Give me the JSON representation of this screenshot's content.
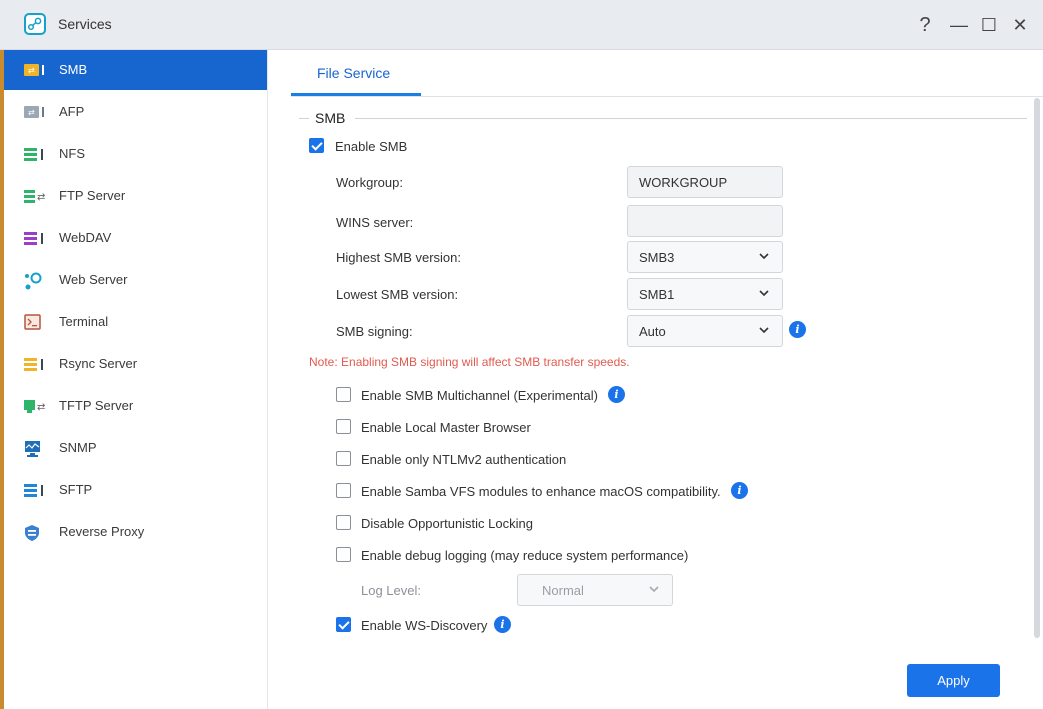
{
  "window": {
    "title": "Services",
    "controls": {
      "help": "?",
      "minimize": "—",
      "maximize": "☐",
      "close": "✕"
    }
  },
  "sidebar": {
    "items": [
      {
        "label": "SMB",
        "icon": "smb-icon",
        "active": true
      },
      {
        "label": "AFP",
        "icon": "afp-icon"
      },
      {
        "label": "NFS",
        "icon": "nfs-icon"
      },
      {
        "label": "FTP Server",
        "icon": "ftp-icon"
      },
      {
        "label": "WebDAV",
        "icon": "webdav-icon"
      },
      {
        "label": "Web Server",
        "icon": "web-server-icon"
      },
      {
        "label": "Terminal",
        "icon": "terminal-icon"
      },
      {
        "label": "Rsync Server",
        "icon": "rsync-icon"
      },
      {
        "label": "TFTP Server",
        "icon": "tftp-icon"
      },
      {
        "label": "SNMP",
        "icon": "snmp-icon"
      },
      {
        "label": "SFTP",
        "icon": "sftp-icon"
      },
      {
        "label": "Reverse Proxy",
        "icon": "reverse-proxy-icon"
      }
    ]
  },
  "tabs": [
    {
      "label": "File Service",
      "active": true
    }
  ],
  "smb": {
    "section_title": "SMB",
    "enable_smb": {
      "label": "Enable SMB",
      "checked": true
    },
    "workgroup": {
      "label": "Workgroup:",
      "value": "WORKGROUP"
    },
    "wins_server": {
      "label": "WINS server:",
      "value": ""
    },
    "highest_version": {
      "label": "Highest SMB version:",
      "value": "SMB3"
    },
    "lowest_version": {
      "label": "Lowest SMB version:",
      "value": "SMB1"
    },
    "signing": {
      "label": "SMB signing:",
      "value": "Auto"
    },
    "note": "Note: Enabling SMB signing will affect SMB transfer speeds.",
    "options": [
      {
        "label": "Enable SMB Multichannel (Experimental)",
        "checked": false,
        "info": true
      },
      {
        "label": "Enable Local Master Browser",
        "checked": false
      },
      {
        "label": "Enable only NTLMv2 authentication",
        "checked": false
      },
      {
        "label": "Enable Samba VFS modules to enhance macOS compatibility.",
        "checked": false,
        "info": true
      },
      {
        "label": "Disable Opportunistic Locking",
        "checked": false
      },
      {
        "label": "Enable debug logging (may reduce system performance)",
        "checked": false
      }
    ],
    "log_level": {
      "label": "Log Level:",
      "value": "Normal",
      "disabled": true
    },
    "ws_discovery": {
      "label": "Enable WS-Discovery",
      "checked": true,
      "info": true
    }
  },
  "apply_label": "Apply",
  "colors": {
    "accent": "#1765cf",
    "note": "#e25a4f",
    "checkbox": "#1a73e8"
  }
}
